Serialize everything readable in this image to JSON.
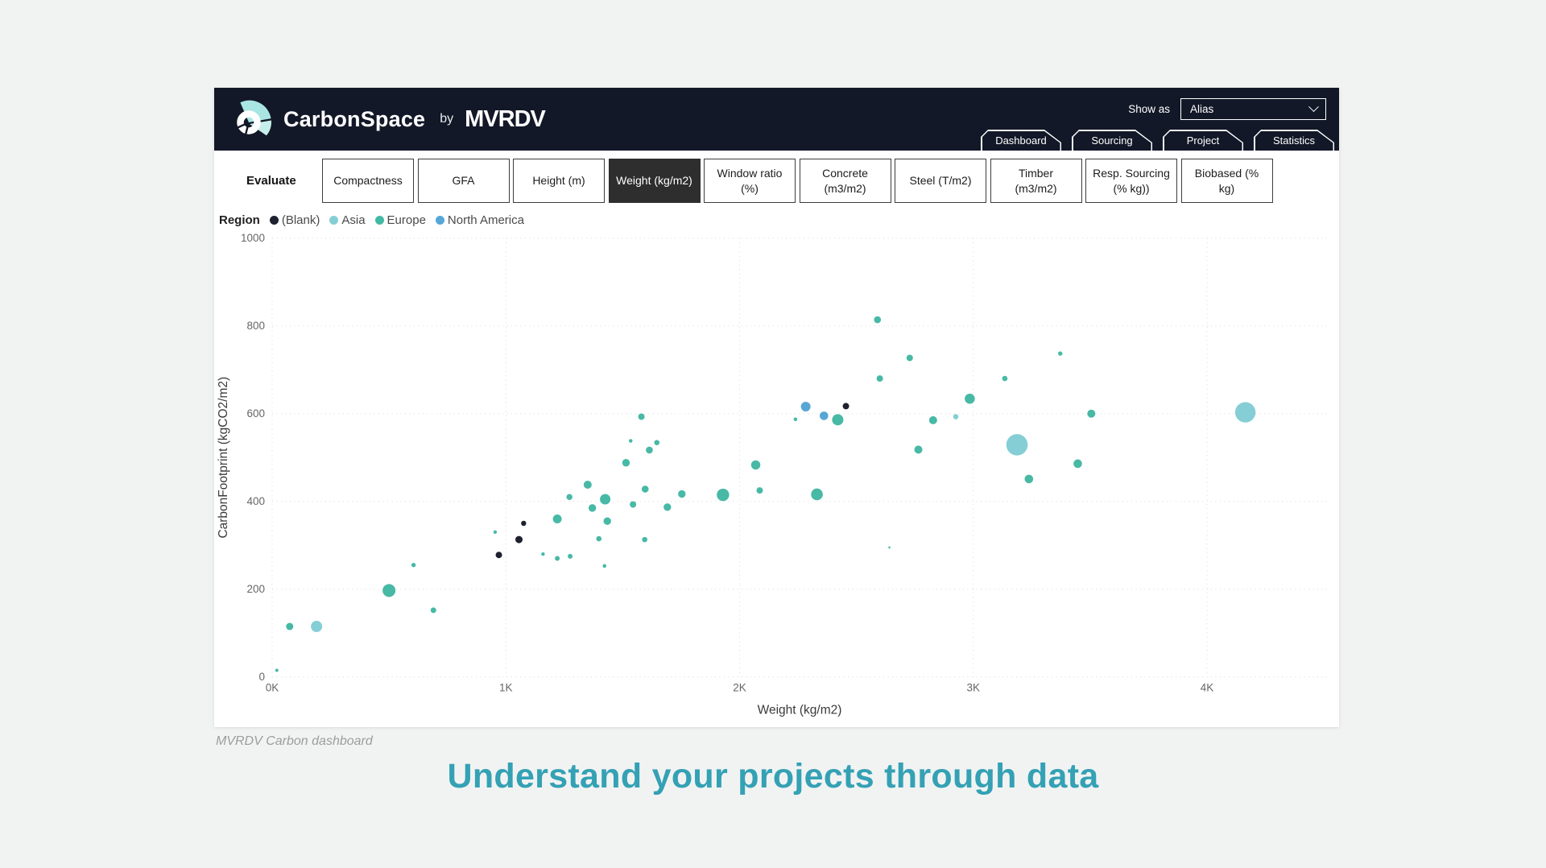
{
  "header": {
    "app_name": "CarbonSpace",
    "by": "by",
    "brand": "MVRDV",
    "show_as_label": "Show as",
    "show_as_value": "Alias",
    "tabs": [
      {
        "label": "Dashboard"
      },
      {
        "label": "Sourcing"
      },
      {
        "label": "Project"
      },
      {
        "label": "Statistics"
      }
    ]
  },
  "evaluate": {
    "label": "Evaluate",
    "buttons": [
      {
        "label": "Compactness",
        "selected": false
      },
      {
        "label": "GFA",
        "selected": false
      },
      {
        "label": "Height (m)",
        "selected": false
      },
      {
        "label": "Weight (kg/m2)",
        "selected": true
      },
      {
        "label": "Window ratio (%)",
        "selected": false
      },
      {
        "label": "Concrete (m3/m2)",
        "selected": false
      },
      {
        "label": "Steel (T/m2)",
        "selected": false
      },
      {
        "label": "Timber (m3/m2)",
        "selected": false
      },
      {
        "label": "Resp. Sourcing (% kg))",
        "selected": false
      },
      {
        "label": "Biobased (% kg)",
        "selected": false
      }
    ]
  },
  "legend": {
    "title": "Region",
    "items": [
      {
        "label": "(Blank)",
        "color": "#1d2130"
      },
      {
        "label": "Asia",
        "color": "#85ced5"
      },
      {
        "label": "Europe",
        "color": "#42b9a4"
      },
      {
        "label": "North America",
        "color": "#55a7d7"
      }
    ]
  },
  "chart_data": {
    "type": "scatter",
    "xlabel": "Weight (kg/m2)",
    "ylabel": "CarbonFootprint (kgCO2/m2)",
    "xlim": [
      0,
      4000
    ],
    "ylim": [
      0,
      1000
    ],
    "grid": "dotted",
    "legend_position": "top-left",
    "x_ticks": [
      {
        "value": 0,
        "label": "0K"
      },
      {
        "value": 1000,
        "label": "1K"
      },
      {
        "value": 2000,
        "label": "2K"
      },
      {
        "value": 3000,
        "label": "3K"
      },
      {
        "value": 4000,
        "label": "4K"
      }
    ],
    "y_ticks": [
      0,
      200,
      400,
      600,
      800,
      1000
    ],
    "series": [
      {
        "name": "Asia",
        "color": "#85ced5",
        "points": [
          [
            190,
            115,
            7
          ],
          [
            2925,
            593,
            3.3
          ],
          [
            3187,
            529,
            13.3
          ],
          [
            4164,
            603,
            12.7
          ]
        ]
      },
      {
        "name": "Europe",
        "color": "#47b9a5",
        "points": [
          [
            20,
            15,
            2
          ],
          [
            75,
            115,
            4.5
          ],
          [
            500,
            197,
            8
          ],
          [
            605,
            255,
            2.7
          ],
          [
            690,
            152,
            3.5
          ],
          [
            954,
            330,
            2.2
          ],
          [
            1159,
            280,
            2.2
          ],
          [
            1220,
            270,
            3
          ],
          [
            1275,
            275,
            3
          ],
          [
            1422,
            253,
            2.3
          ],
          [
            1220,
            360,
            5.5
          ],
          [
            1272,
            410,
            3.7
          ],
          [
            1350,
            438,
            5
          ],
          [
            1425,
            405,
            6.5
          ],
          [
            1370,
            385,
            4.7
          ],
          [
            1434,
            355,
            4.7
          ],
          [
            1398,
            315,
            3.3
          ],
          [
            1544,
            393,
            4
          ],
          [
            1594,
            313,
            3.3
          ],
          [
            1596,
            428,
            4.3
          ],
          [
            1691,
            387,
            4.7
          ],
          [
            1753,
            417,
            4.7
          ],
          [
            1929,
            415,
            7.7
          ],
          [
            2086,
            425,
            4
          ],
          [
            1580,
            593,
            4
          ],
          [
            1534,
            538,
            2.3
          ],
          [
            1646,
            534,
            3.3
          ],
          [
            1614,
            517,
            4.3
          ],
          [
            1514,
            488,
            4.7
          ],
          [
            2069,
            483,
            5.7
          ],
          [
            2239,
            587,
            2.3
          ],
          [
            2420,
            586,
            7
          ],
          [
            2331,
            416,
            7.3
          ],
          [
            2590,
            814,
            4.3
          ],
          [
            2600,
            680,
            4
          ],
          [
            2641,
            295,
            1.3
          ],
          [
            2728,
            727,
            4
          ],
          [
            2765,
            518,
            5
          ],
          [
            2828,
            585,
            5
          ],
          [
            2985,
            634,
            6.3
          ],
          [
            3135,
            680,
            3.3
          ],
          [
            3238,
            451,
            5.3
          ],
          [
            3372,
            737,
            2.7
          ],
          [
            3447,
            486,
            5.3
          ],
          [
            3505,
            600,
            5
          ]
        ]
      },
      {
        "name": "North America",
        "color": "#58a6d6",
        "points": [
          [
            2283,
            616,
            6
          ],
          [
            2361,
            595,
            5.3
          ]
        ]
      },
      {
        "name": "(Blank)",
        "color": "#1d2130",
        "points": [
          [
            970,
            278,
            4
          ],
          [
            1056,
            313,
            4.5
          ],
          [
            1076,
            350,
            3.2
          ],
          [
            2455,
            617,
            4
          ]
        ]
      }
    ]
  },
  "footer": {
    "caption": "MVRDV Carbon dashboard",
    "headline": "Understand your projects through data"
  }
}
